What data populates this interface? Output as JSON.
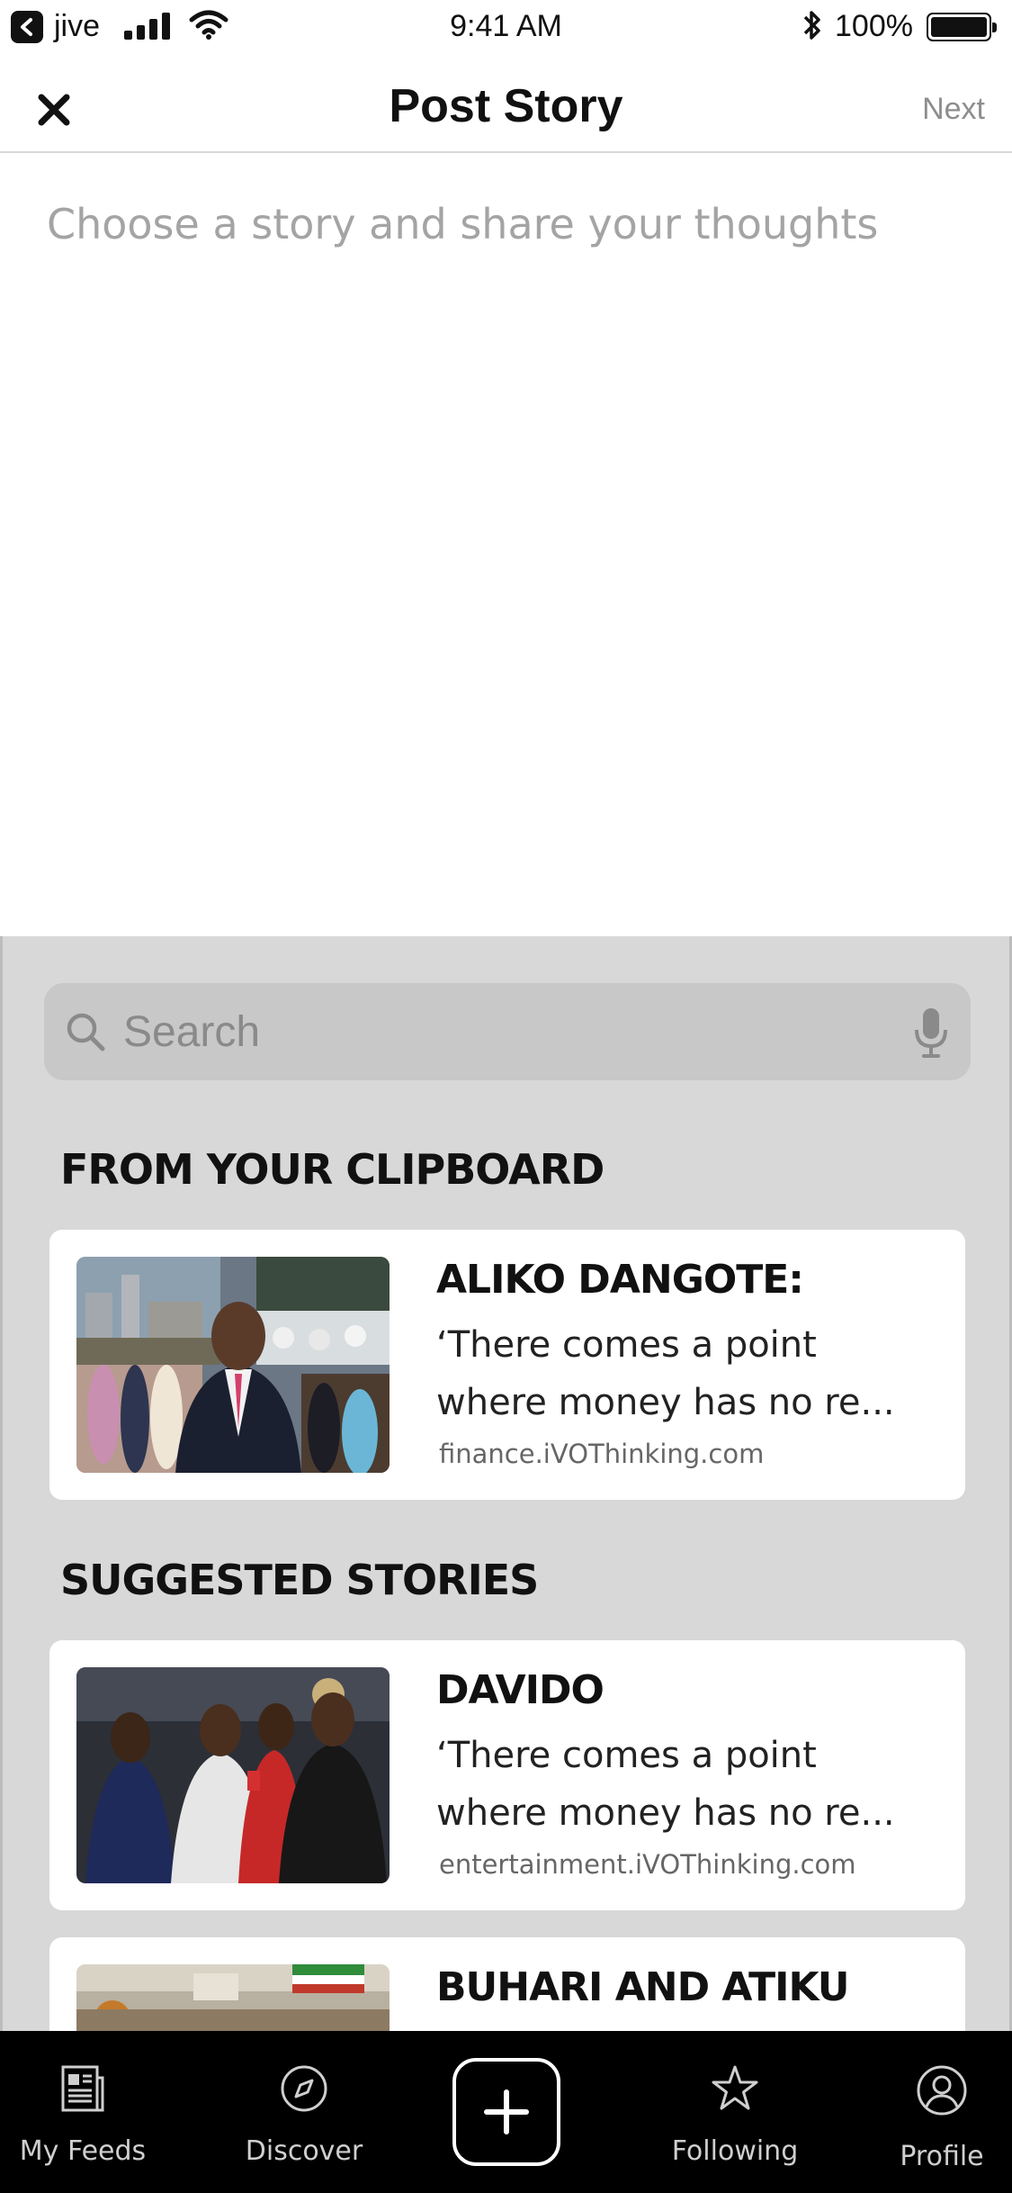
{
  "status_bar": {
    "back_app": "jive",
    "time": "9:41 AM",
    "battery": "100%",
    "battery_level": 1.0
  },
  "header": {
    "title": "Post Story",
    "next_label": "Next",
    "close_icon": "close-icon"
  },
  "compose": {
    "placeholder": "Choose a story and share your thoughts"
  },
  "search": {
    "placeholder": "Search",
    "icon": "search-icon",
    "mic_icon": "microphone-icon"
  },
  "clipboard": {
    "header": "FROM YOUR CLIPBOARD",
    "story": {
      "title": "ALIKO DANGOTE:",
      "excerpt": "‘There comes a point where money has no re...",
      "source": "finance.iVOThinking.com"
    }
  },
  "suggested": {
    "header": "SUGGESTED STORIES",
    "stories": [
      {
        "title": "DAVIDO",
        "excerpt": "‘There comes a point where money has no re...",
        "source": "entertainment.iVOThinking.com"
      },
      {
        "title": "BUHARI AND ATIKU"
      }
    ]
  },
  "tab_bar": {
    "tabs": [
      {
        "label": "My Feeds",
        "icon": "newspaper-icon"
      },
      {
        "label": "Discover",
        "icon": "compass-icon"
      },
      {
        "label": "Following",
        "icon": "star-icon"
      },
      {
        "label": "Profile",
        "icon": "person-icon"
      }
    ],
    "add_icon": "plus-icon"
  },
  "colors": {
    "sheet_background": "#d8d8d8",
    "tab_bar_background": "#000000",
    "muted_text": "#8e8e8e"
  }
}
